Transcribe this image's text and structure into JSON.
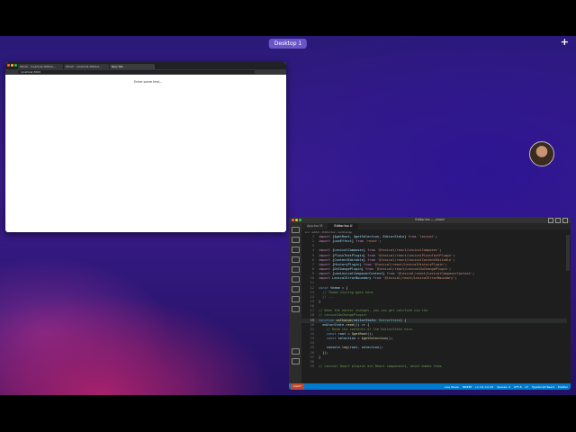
{
  "desktop": {
    "space_label": "Desktop 1",
    "add_label": "+"
  },
  "browser": {
    "tabs": [
      {
        "label": "Which · localhost:3000/e..."
      },
      {
        "label": "Which · localhost:3000/e..."
      },
      {
        "label": "New Tab"
      }
    ],
    "url": "localhost:3000",
    "page_text": "Enter some text..."
  },
  "vscode": {
    "title": "Editor.tsx — yhard",
    "tabs": [
      {
        "label": "App.tsx M"
      },
      {
        "label": "Editor.tsx U"
      }
    ],
    "breadcrumb": "src › editor › Editor.tsx › onChange",
    "lines": [
      {
        "n": "1",
        "html": "<span class='kw'>import</span> <span class='pl'>{</span><span class='id'>$getRoot</span><span class='pl'>, </span><span class='id'>$getSelection</span><span class='pl'>, </span><span class='id'>EditorState</span><span class='pl'>}</span> <span class='kw'>from</span> <span class='str'>'lexical'</span><span class='pl'>;</span>"
      },
      {
        "n": "2",
        "html": "<span class='kw'>import</span> <span class='pl'>{</span><span class='id'>useEffect</span><span class='pl'>}</span> <span class='kw'>from</span> <span class='str'>'react'</span><span class='pl'>;</span>"
      },
      {
        "n": "3",
        "html": ""
      },
      {
        "n": "4",
        "html": "<span class='kw'>import</span> <span class='pl'>{</span><span class='id'>LexicalComposer</span><span class='pl'>}</span> <span class='kw'>from</span> <span class='str'>'@lexical/react/LexicalComposer'</span><span class='pl'>;</span>"
      },
      {
        "n": "5",
        "html": "<span class='kw'>import</span> <span class='pl'>{</span><span class='id'>PlainTextPlugin</span><span class='pl'>}</span> <span class='kw'>from</span> <span class='str'>'@lexical/react/LexicalPlainTextPlugin'</span><span class='pl'>;</span>"
      },
      {
        "n": "6",
        "html": "<span class='kw'>import</span> <span class='pl'>{</span><span class='id'>ContentEditable</span><span class='pl'>}</span> <span class='kw'>from</span> <span class='str'>'@lexical/react/LexicalContentEditable'</span><span class='pl'>;</span>"
      },
      {
        "n": "7",
        "html": "<span class='kw'>import</span> <span class='pl'>{</span><span class='id'>HistoryPlugin</span><span class='pl'>}</span> <span class='kw'>from</span> <span class='str'>'@lexical/react/LexicalHistoryPlugin'</span><span class='pl'>;</span>"
      },
      {
        "n": "8",
        "html": "<span class='kw'>import</span> <span class='pl'>{</span><span class='id'>OnChangePlugin</span><span class='pl'>}</span> <span class='kw'>from</span> <span class='str'>'@lexical/react/LexicalOnChangePlugin'</span><span class='pl'>;</span>"
      },
      {
        "n": "9",
        "html": "<span class='kw'>import</span> <span class='pl'>{</span><span class='id'>useLexicalComposerContext</span><span class='pl'>}</span> <span class='kw'>from</span> <span class='str'>'@lexical/react/LexicalComposerContext'</span><span class='pl'>;</span>"
      },
      {
        "n": "10",
        "html": "<span class='kw'>import</span> <span class='id'>LexicalErrorBoundary</span> <span class='kw'>from</span> <span class='str'>'@lexical/react/LexicalErrorBoundary'</span><span class='pl'>;</span>"
      },
      {
        "n": "11",
        "html": ""
      },
      {
        "n": "12",
        "html": "<span class='bl'>const</span> <span class='id'>theme</span> <span class='pl'>= {</span>"
      },
      {
        "n": "13",
        "html": "  <span class='cm'>// Theme styling goes here</span>"
      },
      {
        "n": "14",
        "html": "  <span class='cm'>// ...</span>"
      },
      {
        "n": "15",
        "html": "<span class='pl'>}</span>"
      },
      {
        "n": "16",
        "html": ""
      },
      {
        "n": "17",
        "html": "<span class='cm'>// When the editor changes, you can get notified via the</span>"
      },
      {
        "n": "18",
        "html": "<span class='cm'>// LexicalOnChangePlugin!</span>"
      },
      {
        "n": "19",
        "html": "<span class='bl'>function</span> <span class='fn'>onChange</span><span class='pl'>(</span><span class='id'>editorState</span><span class='pl'>: </span><span class='ty'>EditorState</span><span class='pl'>) {</span>"
      },
      {
        "n": "20",
        "html": "  <span class='id'>editorState</span><span class='pl'>.</span><span class='fn'>read</span><span class='pl'>(() =&gt; {</span>"
      },
      {
        "n": "21",
        "html": "    <span class='cm'>// Read the contents of the EditorState here.</span>"
      },
      {
        "n": "22",
        "html": "    <span class='bl'>const</span> <span class='id'>root</span> <span class='pl'>= </span><span class='fn'>$getRoot</span><span class='pl'>();</span>"
      },
      {
        "n": "23",
        "html": "    <span class='bl'>const</span> <span class='id'>selection</span> <span class='pl'>= </span><span class='fn'>$getSelection</span><span class='pl'>();</span>"
      },
      {
        "n": "24",
        "html": ""
      },
      {
        "n": "25",
        "html": "    <span class='id'>console</span><span class='pl'>.</span><span class='fn'>log</span><span class='pl'>(</span><span class='id'>root</span><span class='pl'>, </span><span class='id'>selection</span><span class='pl'>);</span>"
      },
      {
        "n": "26",
        "html": "  <span class='pl'>});</span>"
      },
      {
        "n": "27",
        "html": "<span class='pl'>}</span>"
      },
      {
        "n": "28",
        "html": ""
      },
      {
        "n": "29",
        "html": "<span class='cm'>// Lexical React plugins are React components, which makes them</span>"
      }
    ],
    "current_line": "19",
    "status_left": "main*",
    "status_items": [
      "Live Share",
      "INSERT",
      "Ln 19, Col 43",
      "Spaces: 4",
      "UTF-8",
      "LF",
      "TypeScript React",
      "Prettier"
    ]
  },
  "colors": {
    "accent": "#007acc",
    "title_bar": "#323233"
  }
}
